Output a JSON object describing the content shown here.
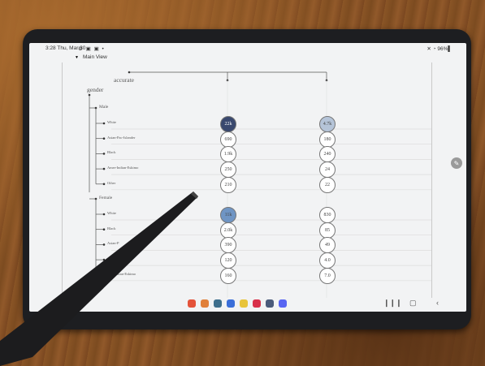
{
  "status": {
    "time": "3:28",
    "date": "Thu, Mar 30",
    "icons": "⚙ ▣ ▣ •",
    "right": "✕ ◔ 96%▌"
  },
  "panel": {
    "title": "Main View"
  },
  "tree": {
    "root_label": "accurate",
    "group_label": "gender",
    "sections": [
      {
        "label": "Male",
        "rows": [
          {
            "label": "White",
            "v1": "22k",
            "v2": "4.7k"
          },
          {
            "label": "Asian-Pac-Islander",
            "v1": "690",
            "v2": "180"
          },
          {
            "label": "Black",
            "v1": "1.9k",
            "v2": "240"
          },
          {
            "label": "Amer-Indian-Eskimo",
            "v1": "250",
            "v2": "24"
          },
          {
            "label": "Other",
            "v1": "210",
            "v2": "22"
          }
        ]
      },
      {
        "label": "Female",
        "rows": [
          {
            "label": "White",
            "v1": "11k",
            "v2": "830"
          },
          {
            "label": "Black",
            "v1": "2.0k",
            "v2": "85"
          },
          {
            "label": "Asian-P",
            "v1": "390",
            "v2": "49"
          },
          {
            "label": "",
            "v1": "120",
            "v2": "4.0"
          },
          {
            "label": "mer-Indian-Eskimo",
            "v1": "160",
            "v2": "7.0"
          }
        ]
      }
    ]
  },
  "highlight_colors": {
    "dark": "#39486e",
    "mid": "#6f95c4",
    "light": "#b5c4d8"
  },
  "dock": {
    "apps": [
      "#e4533a",
      "#e0803a",
      "#3d6e8c",
      "#3b6fd9",
      "#e8c43a",
      "#d8304a",
      "#4a5a7a",
      "#5865f2"
    ]
  }
}
